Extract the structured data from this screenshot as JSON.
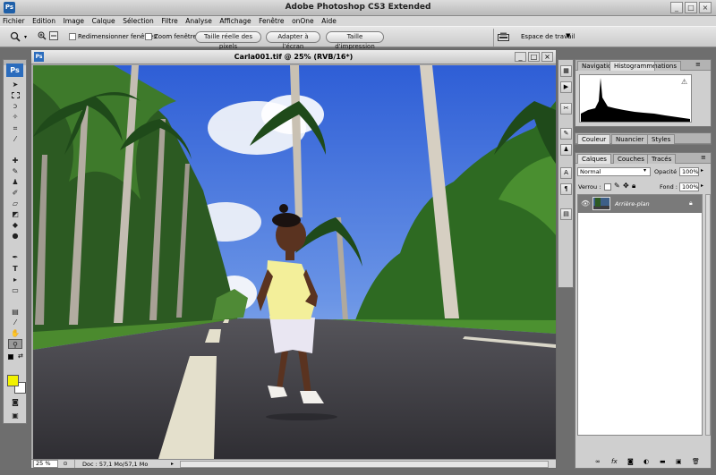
{
  "app": {
    "title": "Adobe Photoshop CS3 Extended",
    "icon_label": "Ps",
    "window_buttons": [
      "_",
      "□",
      "×"
    ]
  },
  "menu": [
    "Fichier",
    "Edition",
    "Image",
    "Calque",
    "Sélection",
    "Filtre",
    "Analyse",
    "Affichage",
    "Fenêtre",
    "onOne",
    "Aide"
  ],
  "options": {
    "resize_windows": "Redimensionner fenêtres",
    "zoom_windows": "Zoom fenêtres",
    "actual_pixels": "Taille réelle des pixels",
    "fit_screen": "Adapter à l'écran",
    "print_size": "Taille d'impression",
    "workspace": "Espace de travail"
  },
  "toolbox": {
    "logo": "Ps"
  },
  "document": {
    "title": "Carla001.tif @ 25% (RVB/16*)",
    "zoom": "25 %",
    "doc_info": "Doc : 57,1 Mo/57,1 Mo"
  },
  "panels": {
    "top_tabs": [
      "Navigation",
      "Histogramme",
      "Informations"
    ],
    "middle_tabs": [
      "Couleur",
      "Nuancier",
      "Styles"
    ],
    "layers_tabs": [
      "Calques",
      "Couches",
      "Tracés"
    ],
    "blend_mode": "Normal",
    "opacity_label": "Opacité :",
    "opacity_value": "100%",
    "lock_label": "Verrou :",
    "fill_label": "Fond :",
    "fill_value": "100%",
    "layer_name": "Arrière-plan"
  },
  "colors": {
    "foreground": "#f2f200",
    "background": "#ffffff",
    "sky": "#4a7be0",
    "asphalt": "#3b3b3f",
    "foliage": "#3f7a2a"
  }
}
